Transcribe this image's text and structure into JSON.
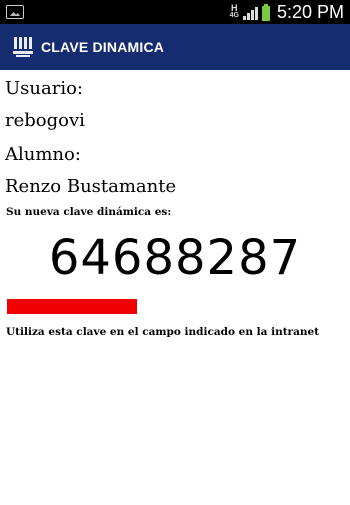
{
  "status_bar": {
    "network_top": "H",
    "network_bottom": "4G",
    "time": "5:20 PM"
  },
  "app_bar": {
    "title": "CLAVE DINAMICA",
    "logo_icon": "university-building-icon"
  },
  "user": {
    "usuario_label": "Usuario:",
    "usuario_value": "rebogovi",
    "alumno_label": "Alumno:",
    "alumno_value": "Renzo Bustamante"
  },
  "clave": {
    "label": "Su nueva clave dinámica es:",
    "value": "64688287",
    "timer_progress": 1.0,
    "timer_color": "#f00000",
    "instruction": "Utiliza esta clave en el campo indicado en la intranet"
  },
  "colors": {
    "app_bar": "#162c70",
    "status_bar": "#000000"
  }
}
